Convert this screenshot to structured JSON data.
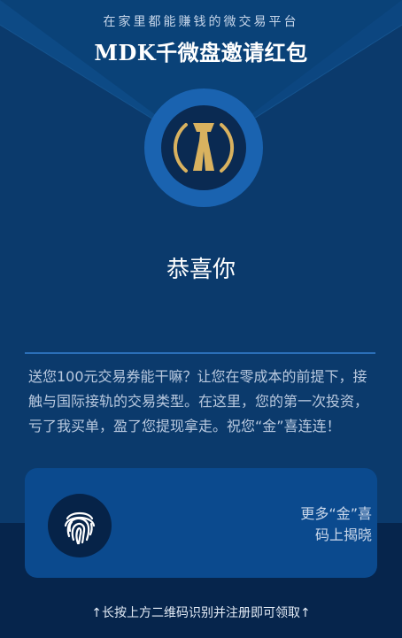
{
  "header": {
    "subtitle": "在家里都能赚钱的微交易平台",
    "title": "MDK千微盘邀请红包"
  },
  "badge": {
    "icon": "gold-trophy-logo-icon"
  },
  "main": {
    "congrats": "恭喜你",
    "message": "送您100元交易券能干嘛？让您在零成本的前提下，接触与国际接轨的交易类型。在这里，您的第一次投资，亏了我买单，盈了您提现拿走。祝您“金”喜连连！"
  },
  "card": {
    "icon": "fingerprint-icon",
    "line1": "更多“金”喜",
    "line2": "码上揭晓"
  },
  "footer": {
    "hint": "↑长按上方二维码识别并注册即可领取↑"
  },
  "colors": {
    "background": "#0b3a6c",
    "badge_ring": "#1a63b0",
    "gold": "#d9b25f",
    "card": "#0b4a8e"
  }
}
